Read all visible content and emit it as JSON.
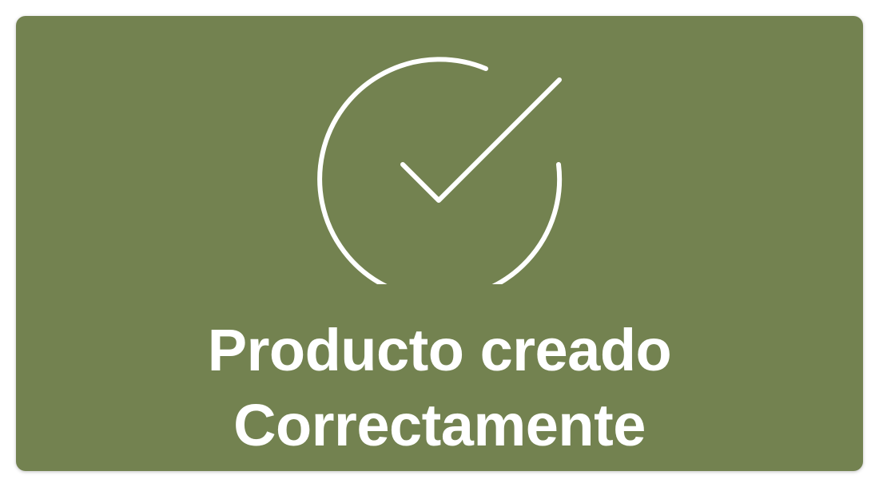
{
  "toast": {
    "background_color": "#738250",
    "foreground_color": "#ffffff",
    "icon": "check-circle-icon",
    "message_line1": "Producto creado",
    "message_line2": "Correctamente"
  }
}
